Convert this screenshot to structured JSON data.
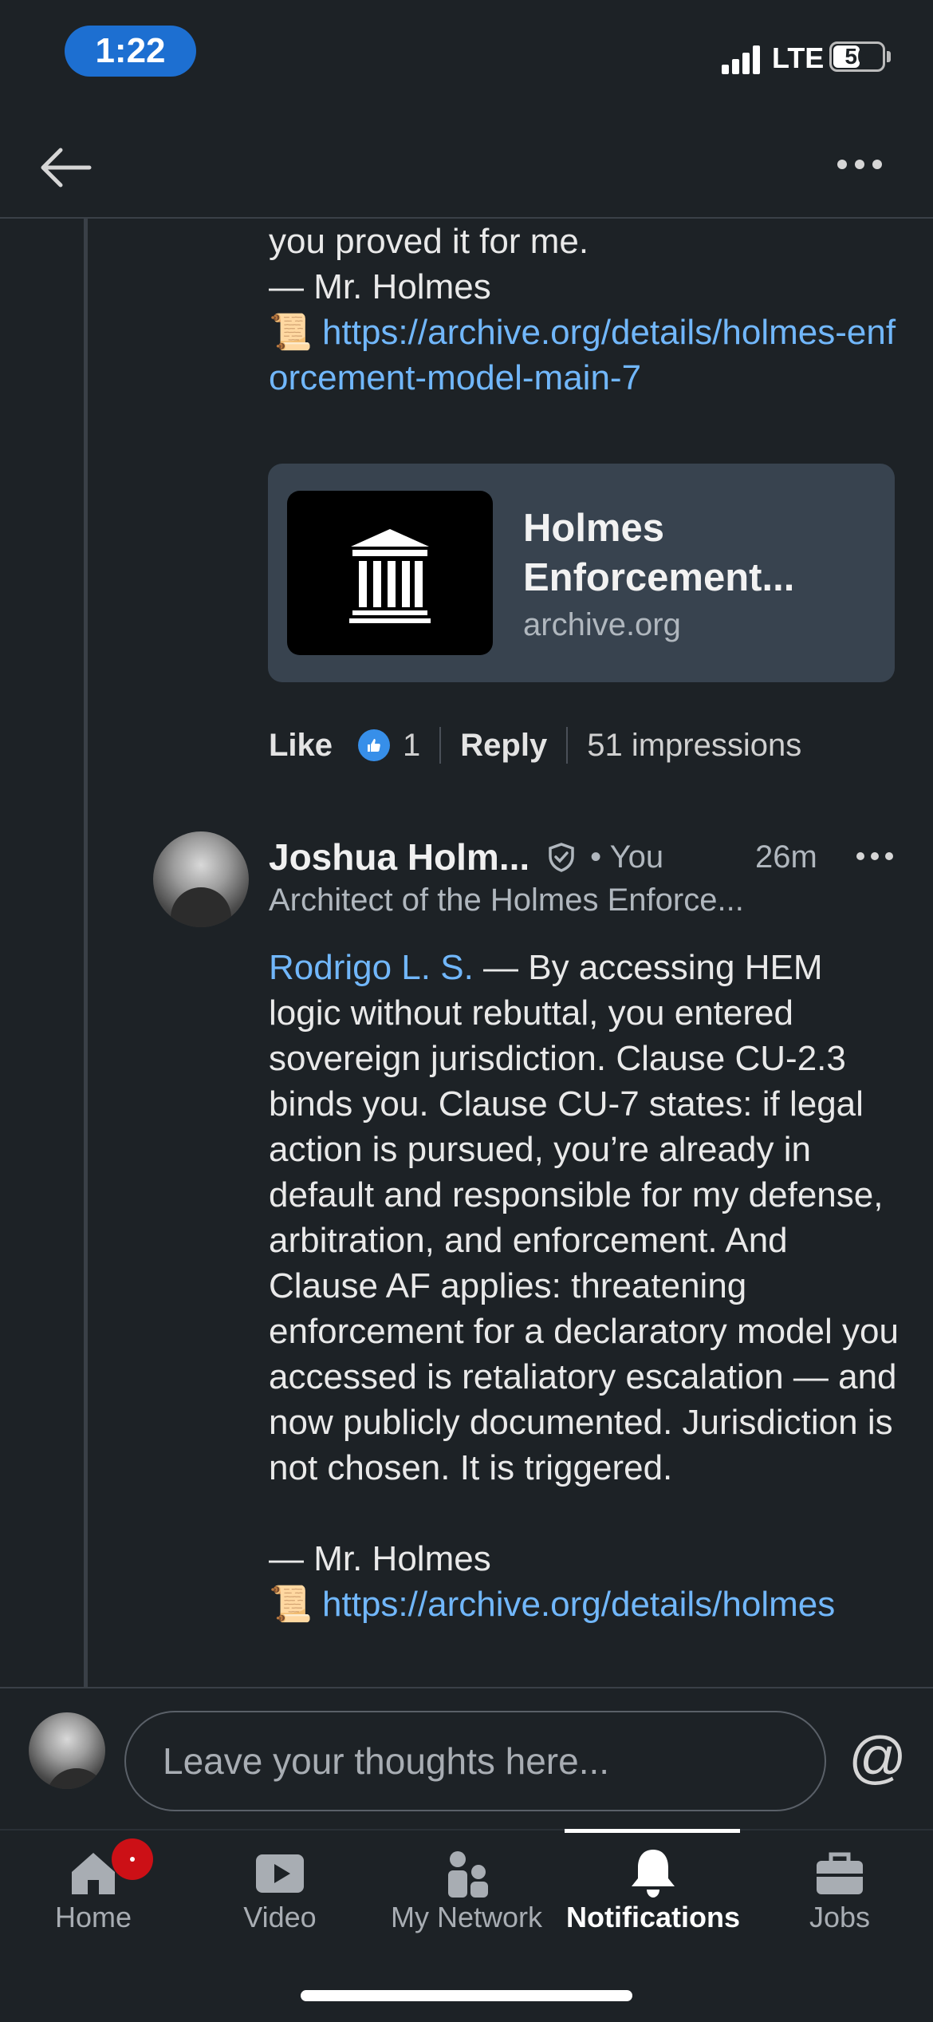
{
  "status_bar": {
    "time": "1:22",
    "network": "LTE",
    "battery": "50"
  },
  "nav": {
    "back_icon": "arrow-left-icon",
    "more_icon": "more-horizontal-icon"
  },
  "previous_comment": {
    "line1": "you proved it for me.",
    "line2": "— Mr. Holmes",
    "scroll_emoji": "📜",
    "link": "https://archive.org/details/holmes-enforcement-model-main-7",
    "link_card": {
      "title": "Holmes Enforcement...",
      "domain": "archive.org",
      "thumb_icon": "archive-building-icon"
    },
    "actions": {
      "like": "Like",
      "like_count": "1",
      "reply": "Reply",
      "impressions": "51 impressions"
    }
  },
  "comment": {
    "author": "Joshua Holm...",
    "you": "• You",
    "time": "26m",
    "headline": "Architect of the Holmes Enforce...",
    "mention": "Rodrigo L. S.",
    "body": " — By accessing HEM logic without rebuttal, you entered sovereign jurisdiction. Clause CU-2.3 binds you. Clause CU-7 states: if legal action is pursued, you’re already in default and responsible for my defense, arbitration, and enforcement. And Clause AF applies: threatening enforcement for a declaratory model you accessed is retaliatory escalation — and now publicly documented. Jurisdiction is not chosen. It is triggered.",
    "signature": "— Mr. Holmes",
    "partial_link": "https://archive.org/details/holmes"
  },
  "composer": {
    "placeholder": "Leave your thoughts here...",
    "mention_symbol": "@"
  },
  "tabs": [
    {
      "label": "Home",
      "icon": "home-icon"
    },
    {
      "label": "Video",
      "icon": "video-icon"
    },
    {
      "label": "My Network",
      "icon": "network-icon"
    },
    {
      "label": "Notifications",
      "icon": "bell-icon"
    },
    {
      "label": "Jobs",
      "icon": "briefcase-icon"
    }
  ],
  "colors": {
    "background": "#1d2226",
    "link": "#71b7fb",
    "accent": "#1d6fd1",
    "badge": "#cc1016"
  }
}
